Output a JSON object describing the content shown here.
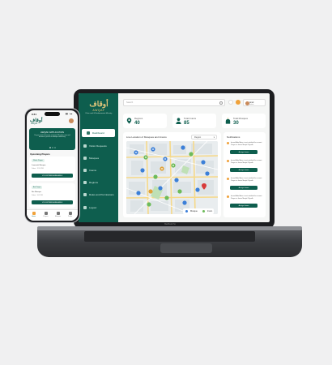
{
  "brand": {
    "logo_ar": "أوقاف",
    "logo_en": "AWQAF",
    "tagline": "Khos and & Endowments Ministry",
    "accent": "#0e5e4e",
    "gold": "#e3c67a",
    "laptop_label": "MacBook Pro"
  },
  "dashboard": {
    "sidebar": {
      "items": [
        {
          "label": "Dashboard",
          "icon": "grid-icon",
          "active": true
        },
        {
          "label": "Visitor Requests",
          "icon": "users-icon",
          "active": false
        },
        {
          "label": "Mosques",
          "icon": "mosque-icon",
          "active": false
        },
        {
          "label": "Imams",
          "icon": "person-icon",
          "active": false
        },
        {
          "label": "Regions",
          "icon": "map-icon",
          "active": false
        },
        {
          "label": "Roles and Permissions",
          "icon": "shield-icon",
          "active": false
        },
        {
          "label": "Logout",
          "icon": "logout-icon",
          "active": false
        }
      ]
    },
    "topbar": {
      "search_placeholder": "Search",
      "user_name": "Arad",
      "user_role": "Admin"
    },
    "stats": [
      {
        "label": "Regions",
        "value": "40"
      },
      {
        "label": "Total Imams",
        "value": "85"
      },
      {
        "label": "Total Mosques",
        "value": "30"
      }
    ],
    "map": {
      "title": "Live Location of Mosques and Imams",
      "filter_value": "Region",
      "legend": [
        {
          "label": "Mosque",
          "color": "#3b7fd8"
        },
        {
          "label": "Imam",
          "color": "#6dbb5a"
        }
      ]
    },
    "notifications": {
      "title": "Notifications",
      "items": [
        {
          "text": "Imam Abdul Azim is not satisfied for current Prayer in Jamia Masjid. Riyadh",
          "button": "Assign Imam"
        },
        {
          "text": "Imam Abdul Azim is not satisfied for current Prayer in Jamia Masjid. Riyadh",
          "button": "Assign Imam"
        },
        {
          "text": "Imam Abdul Azim is not satisfied for current Prayer in Jamia Masjid. Riyadh",
          "button": "Assign Imam"
        },
        {
          "text": "Imam Abdul Azim is not satisfied for current Prayer in Jamia Masjid. Riyadh",
          "button": "Assign Imam"
        }
      ]
    }
  },
  "phone": {
    "time": "9:41",
    "status_icons": "▮▮ ◔ ▬",
    "hero": {
      "title": "AWQAF APPLICATION",
      "text": "Do you want to become an Imam? Register now and become a part of our Awqaf community."
    },
    "section_title": "Upcoming Prayers",
    "cards": [
      {
        "chip": "Dhuhr Prayer",
        "mosque": "Jumeirah Mosque",
        "meta": "Dubai · 12:30 PM",
        "button": "VOLUNTEER AVAILABLE"
      },
      {
        "chip": "Asr Prayer",
        "mosque": "Nur Mosque",
        "meta": "Dubai · 3:45 PM",
        "button": "VOLUNTEER AVAILABLE"
      }
    ],
    "tabs": [
      {
        "label": "Home",
        "active": true
      },
      {
        "label": "Prayers",
        "active": false
      },
      {
        "label": "Mosques",
        "active": false
      },
      {
        "label": "Profile",
        "active": false
      }
    ]
  }
}
